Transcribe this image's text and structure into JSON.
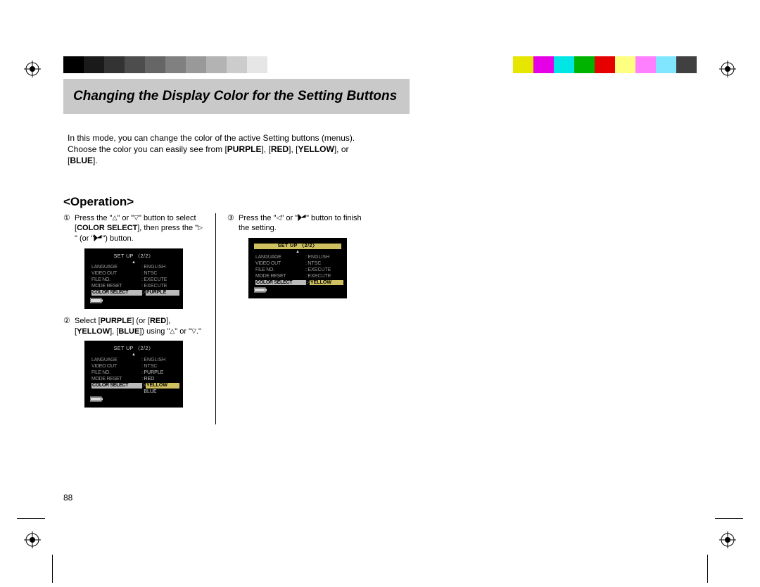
{
  "colorbar_left": [
    "#000000",
    "#1a1a1a",
    "#333333",
    "#4d4d4d",
    "#666666",
    "#808080",
    "#999999",
    "#b3b3b3",
    "#cccccc",
    "#e6e6e6",
    "#ffffff"
  ],
  "colorbar_right": [
    "#e6e600",
    "#e600e6",
    "#00e6e6",
    "#00b300",
    "#e60000",
    "#ffff80",
    "#ff80ff",
    "#80e6ff",
    "#404040"
  ],
  "heading": "Changing the Display Color for the Setting Buttons",
  "intro_1": "In this mode, you can change the color of the active Setting buttons (menus). Choose the color you can easily see from [",
  "intro_purple": "PURPLE",
  "intro_2": "], [",
  "intro_red": "RED",
  "intro_3": "], [",
  "intro_yellow": "YELLOW",
  "intro_4": "], or [",
  "intro_blue": "BLUE",
  "intro_5": "].",
  "operation_heading": "<Operation>",
  "steps": {
    "s1": {
      "num": "①",
      "t1": "Press the \"",
      "t2": "\" or \"",
      "t3": "\" button to select [",
      "cs": "COLOR SELECT",
      "t4": "], then press the \"",
      "t5": "\" (or \"",
      "t6": "\") button."
    },
    "s2": {
      "num": "②",
      "t1": "Select [",
      "p": "PURPLE",
      "t2": "] (or [",
      "r": "RED",
      "t3": "], [",
      "y": "YELLOW",
      "t4": "], [",
      "b": "BLUE",
      "t5": "]) using \"",
      "t6": "\" or \"",
      "t7": ".\""
    },
    "s3": {
      "num": "③",
      "t1": "Press the \"",
      "t2": "\" or \"",
      "t3": "\" button to finish the setting."
    }
  },
  "lcd": {
    "title": "SET UP   〈2/2〉",
    "rows": [
      {
        "l": "LANGUAGE",
        "r": "ENGLISH"
      },
      {
        "l": "VIDEO OUT",
        "r": "NTSC"
      },
      {
        "l": "FILE NO.",
        "r": "EXECUTE"
      },
      {
        "l": "MODE RESET",
        "r": "EXECUTE"
      }
    ],
    "color_row": {
      "l": "COLOR SELECT",
      "r": "PURPLE"
    },
    "color_row_yellow": {
      "l": "COLOR SELECT",
      "r": "YELLOW"
    },
    "opts": [
      "PURPLE",
      "RED",
      "YELLOW",
      "BLUE"
    ]
  },
  "page_number": "88"
}
